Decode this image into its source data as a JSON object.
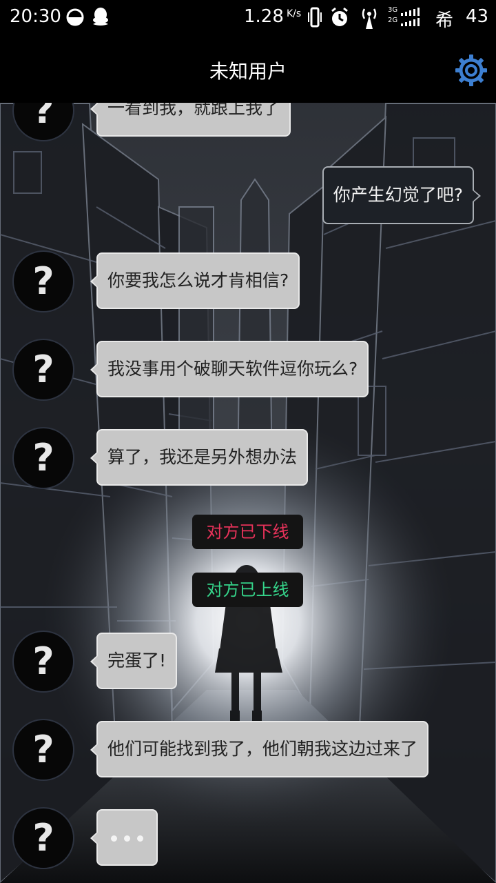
{
  "status_bar": {
    "time": "20:30",
    "speed_value": "1.28",
    "speed_unit": "K/s",
    "signal_gen_1": "3G",
    "signal_gen_2": "2G",
    "carrier_char": "希",
    "battery": "43",
    "icons": [
      "half-moon-icon",
      "qq-icon",
      "vibrate-icon",
      "alarm-icon",
      "antenna-icon",
      "signal-bars-icon"
    ]
  },
  "header": {
    "title": "未知用户",
    "settings_icon": "gear-icon",
    "accent_color": "#3d7fd1"
  },
  "avatar_glyph": "?",
  "messages": [
    {
      "side": "left",
      "text": "一看到我，就跟上我了"
    },
    {
      "side": "right",
      "text": "你产生幻觉了吧?"
    },
    {
      "side": "left",
      "text": "你要我怎么说才肯相信?"
    },
    {
      "side": "left",
      "text": "我没事用个破聊天软件逗你玩么?"
    },
    {
      "side": "left",
      "text": "算了，我还是另外想办法"
    },
    {
      "side": "system",
      "text": "对方已下线",
      "color": "#e8325a"
    },
    {
      "side": "system",
      "text": "对方已上线",
      "color": "#35d48a"
    },
    {
      "side": "left",
      "text": "完蛋了!"
    },
    {
      "side": "left",
      "text": "他们可能找到我了，他们朝我这边过来了"
    },
    {
      "side": "left",
      "typing": true
    }
  ]
}
